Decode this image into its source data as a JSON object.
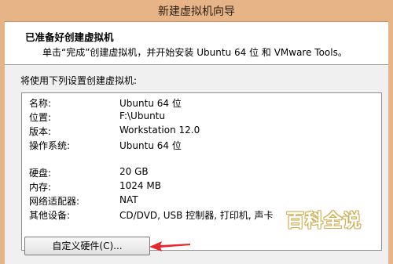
{
  "window": {
    "title": "新建虚拟机向导"
  },
  "header": {
    "title": "已准备好创建虚拟机",
    "subtitle": "单击“完成”创建虚拟机，并开始安装 Ubuntu 64 位 和 VMware Tools。"
  },
  "intro": "将使用下列设置创建虚拟机:",
  "summary": {
    "rows": [
      {
        "key": "名称:",
        "value": "Ubuntu 64 位"
      },
      {
        "key": "位置:",
        "value": "F:\\Ubuntu"
      },
      {
        "key": "版本:",
        "value": "Workstation 12.0"
      },
      {
        "key": "操作系统:",
        "value": "Ubuntu 64 位"
      },
      {
        "key": "硬盘:",
        "value": "20 GB"
      },
      {
        "key": "内存:",
        "value": "1024 MB"
      },
      {
        "key": "网络适配器:",
        "value": "NAT"
      },
      {
        "key": "其他设备:",
        "value": "CD/DVD, USB 控制器, 打印机, 声卡"
      }
    ]
  },
  "buttons": {
    "customize_hardware": "自定义硬件(C)..."
  },
  "watermark": {
    "title": "百科全说",
    "subtitle": "助你轻松解决"
  },
  "colors": {
    "titlebar": "#e7b487",
    "arrow": "#e8262b",
    "watermark_gold": "#d0b055"
  }
}
